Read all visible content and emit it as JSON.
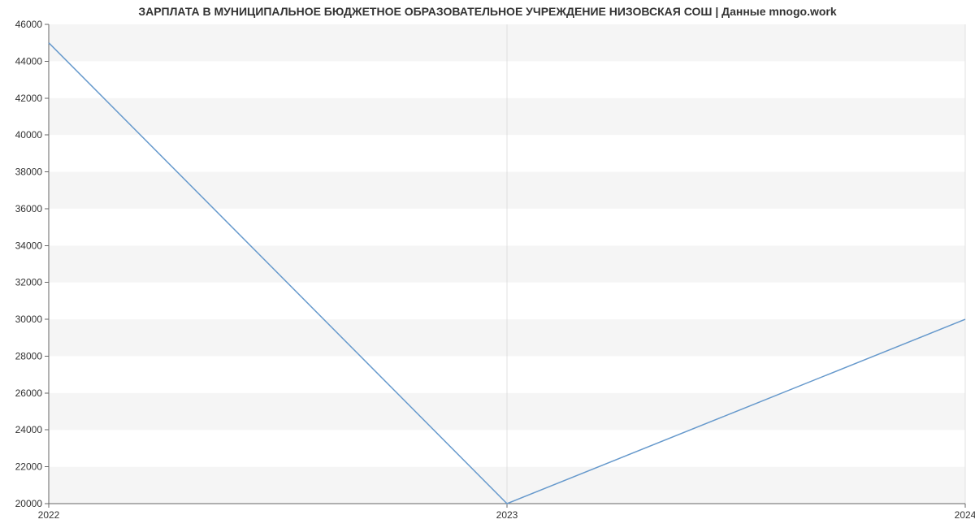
{
  "chart_data": {
    "type": "line",
    "title": "ЗАРПЛАТА В МУНИЦИПАЛЬНОЕ БЮДЖЕТНОЕ ОБРАЗОВАТЕЛЬНОЕ УЧРЕЖДЕНИЕ НИЗОВСКАЯ СОШ | Данные mnogo.work",
    "x": [
      2022,
      2023,
      2024
    ],
    "values": [
      45000,
      20000,
      30000
    ],
    "xlabel": "",
    "ylabel": "",
    "xlim": [
      2022,
      2024
    ],
    "ylim": [
      20000,
      46000
    ],
    "yticks": [
      20000,
      22000,
      24000,
      26000,
      28000,
      30000,
      32000,
      34000,
      36000,
      38000,
      40000,
      42000,
      44000,
      46000
    ],
    "xticks": [
      2022,
      2023,
      2024
    ],
    "colors": {
      "line": "#6699cc",
      "band": "#f5f5f5"
    }
  }
}
